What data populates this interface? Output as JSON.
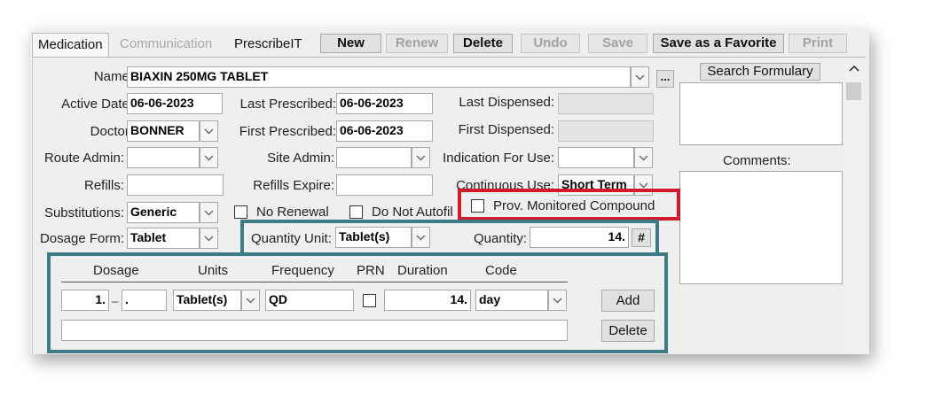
{
  "tabs": [
    {
      "label": "Medication",
      "active": true
    },
    {
      "label": "Communication",
      "active": false,
      "disabled": true
    },
    {
      "label": "PrescribeIT",
      "active": false
    }
  ],
  "toolbar": {
    "new": "New",
    "renew": "Renew",
    "delete": "Delete",
    "undo": "Undo",
    "save": "Save",
    "save_favorite": "Save as a Favorite",
    "print": "Print"
  },
  "form": {
    "name_label": "Name:",
    "name_value": "BIAXIN 250MG TABLET",
    "ellipsis": "...",
    "search_formulary": "Search Formulary",
    "active_date_label": "Active Date:",
    "active_date_value": "06-06-2023",
    "last_prescribed_label": "Last Prescribed:",
    "last_prescribed_value": "06-06-2023",
    "last_dispensed_label": "Last Dispensed:",
    "last_dispensed_value": "",
    "doctor_label": "Doctor:",
    "doctor_value": "BONNER",
    "first_prescribed_label": "First Prescribed:",
    "first_prescribed_value": "06-06-2023",
    "first_dispensed_label": "First Dispensed:",
    "first_dispensed_value": "",
    "route_admin_label": "Route Admin:",
    "route_admin_value": "",
    "site_admin_label": "Site Admin:",
    "site_admin_value": "",
    "indication_label": "Indication For Use:",
    "indication_value": "",
    "comments_label": "Comments:",
    "refills_label": "Refills:",
    "refills_value": "",
    "refills_expire_label": "Refills Expire:",
    "refills_expire_value": "",
    "continuous_use_label": "Continuous Use:",
    "continuous_use_value": "Short Term",
    "substitutions_label": "Substitutions:",
    "substitutions_value": "Generic",
    "no_renewal_label": "No Renewal",
    "do_not_autofill_label": "Do Not Autofil",
    "prov_monitored_label": "Prov. Monitored Compound",
    "dosage_form_label": "Dosage Form:",
    "dosage_form_value": "Tablet",
    "quantity_unit_label": "Quantity Unit:",
    "quantity_unit_value": "Tablet(s)",
    "quantity_label": "Quantity:",
    "quantity_value": "14.",
    "hash_btn": "#"
  },
  "dosage_grid": {
    "headers": {
      "dosage": "Dosage",
      "units": "Units",
      "frequency": "Frequency",
      "prn": "PRN",
      "duration": "Duration",
      "code": "Code"
    },
    "row": {
      "dosage_a": "1.",
      "sep": "_",
      "dosage_b": ".",
      "units": "Tablet(s)",
      "frequency": "QD",
      "duration": "14.",
      "code": "day"
    },
    "add": "Add",
    "delete": "Delete",
    "notes": ""
  },
  "colors": {
    "teal": "#3c7a85",
    "red": "#d21a2b",
    "window_bg": "#efefef"
  }
}
